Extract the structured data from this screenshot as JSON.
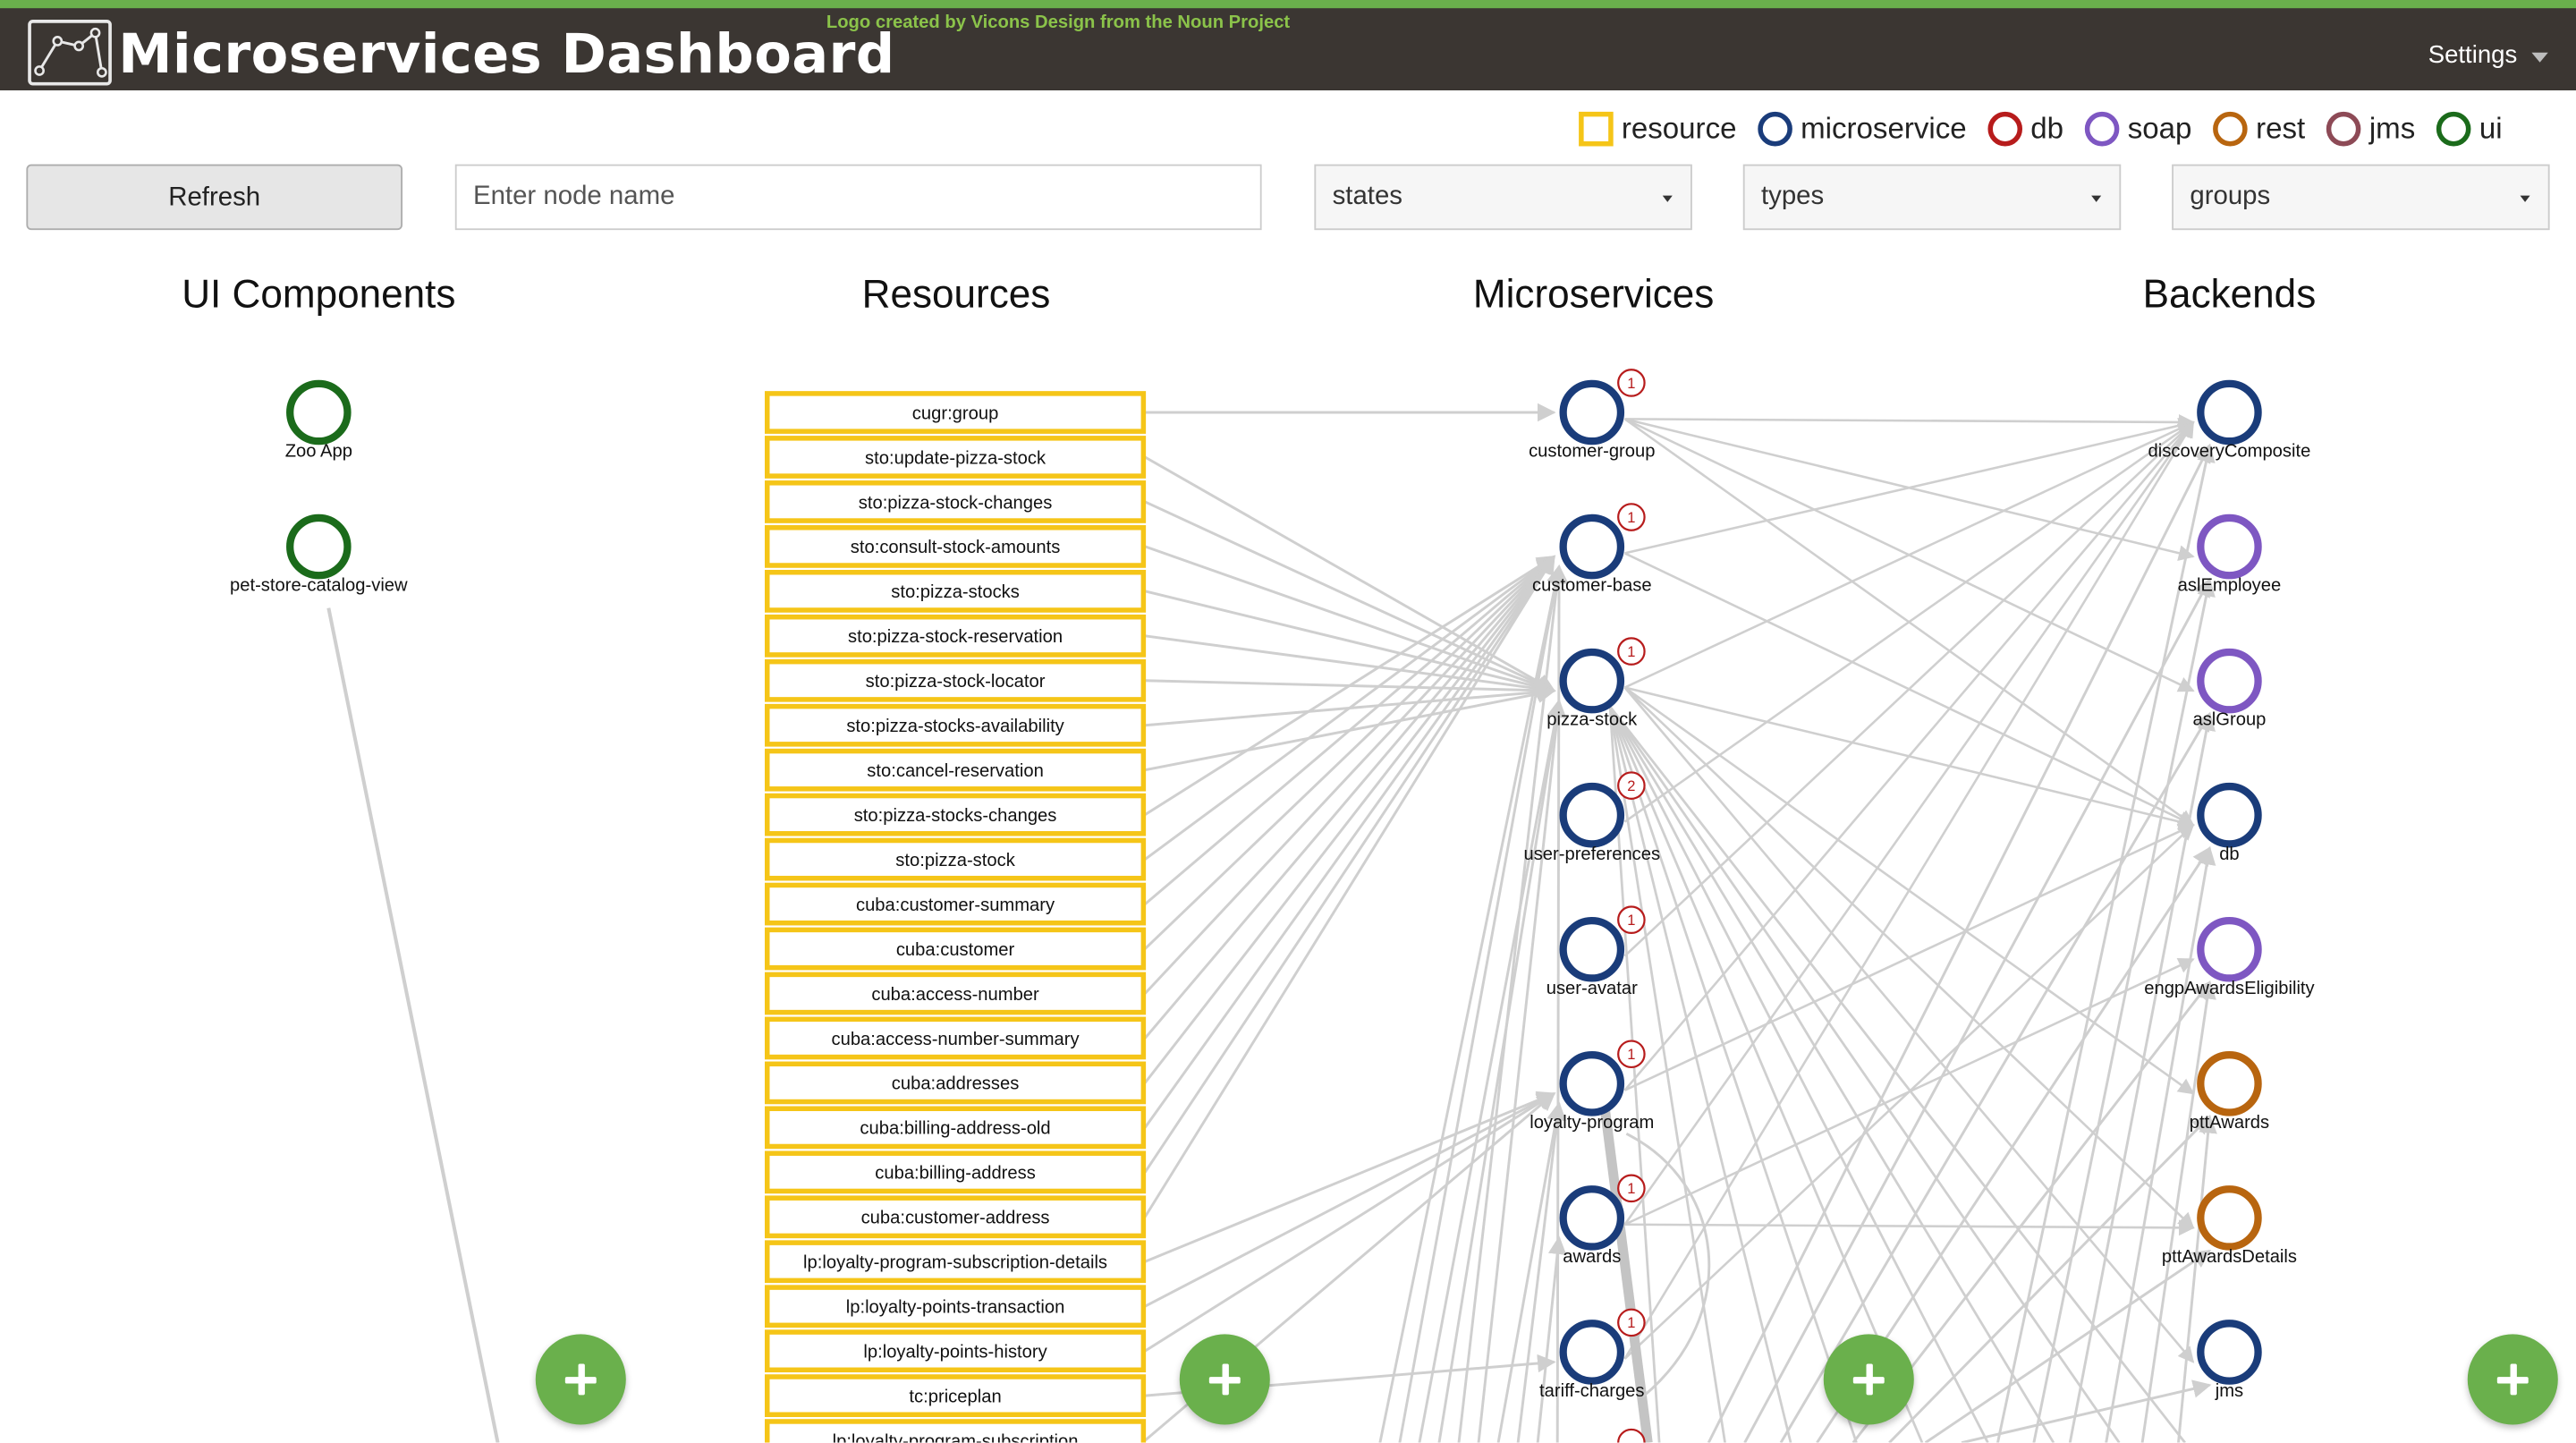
{
  "header": {
    "title": "Microservices Dashboard",
    "credit": "Logo created by Vicons Design from the Noun Project",
    "logo_icon": "graph-line-logo-icon",
    "settings_label": "Settings"
  },
  "legend": [
    {
      "label": "resource",
      "shape": "square",
      "color": "#f5c518"
    },
    {
      "label": "microservice",
      "shape": "circle",
      "color": "#1a3c7a"
    },
    {
      "label": "db",
      "shape": "circle",
      "color": "#b71c1c"
    },
    {
      "label": "soap",
      "shape": "circle",
      "color": "#7e57c2"
    },
    {
      "label": "rest",
      "shape": "circle",
      "color": "#b8650f"
    },
    {
      "label": "jms",
      "shape": "circle",
      "color": "#8d4a56"
    },
    {
      "label": "ui",
      "shape": "circle",
      "color": "#1b6b1b"
    }
  ],
  "controls": {
    "refresh_label": "Refresh",
    "search_placeholder": "Enter node name",
    "states_label": "states",
    "types_label": "types",
    "groups_label": "groups"
  },
  "columns": [
    "UI Components",
    "Resources",
    "Microservices",
    "Backends"
  ],
  "ui_nodes": [
    {
      "label": "Zoo App",
      "type": "ui"
    },
    {
      "label": "pet-store-catalog-view",
      "type": "ui"
    }
  ],
  "resources": [
    "cugr:group",
    "sto:update-pizza-stock",
    "sto:pizza-stock-changes",
    "sto:consult-stock-amounts",
    "sto:pizza-stocks",
    "sto:pizza-stock-reservation",
    "sto:pizza-stock-locator",
    "sto:pizza-stocks-availability",
    "sto:cancel-reservation",
    "sto:pizza-stocks-changes",
    "sto:pizza-stock",
    "cuba:customer-summary",
    "cuba:customer",
    "cuba:access-number",
    "cuba:access-number-summary",
    "cuba:addresses",
    "cuba:billing-address-old",
    "cuba:billing-address",
    "cuba:customer-address",
    "lp:loyalty-program-subscription-details",
    "lp:loyalty-points-transaction",
    "lp:loyalty-points-history",
    "tc:priceplan",
    "lp:loyalty-program-subscription"
  ],
  "microservices": [
    {
      "label": "customer-group",
      "badge": "1"
    },
    {
      "label": "customer-base",
      "badge": "1"
    },
    {
      "label": "pizza-stock",
      "badge": "1"
    },
    {
      "label": "user-preferences",
      "badge": "2"
    },
    {
      "label": "user-avatar",
      "badge": "1"
    },
    {
      "label": "loyalty-program",
      "badge": "1"
    },
    {
      "label": "awards",
      "badge": "1"
    },
    {
      "label": "tariff-charges",
      "badge": "1"
    }
  ],
  "backends": [
    {
      "label": "discoveryComposite",
      "type": "microservice"
    },
    {
      "label": "aslEmployee",
      "type": "soap"
    },
    {
      "label": "aslGroup",
      "type": "soap"
    },
    {
      "label": "db",
      "type": "microservice"
    },
    {
      "label": "engpAwardsEligibility",
      "type": "soap"
    },
    {
      "label": "pttAwards",
      "type": "rest"
    },
    {
      "label": "pttAwardsDetails",
      "type": "rest"
    },
    {
      "label": "jms",
      "type": "microservice"
    }
  ],
  "colors": {
    "ui": "#1b6b1b",
    "microservice": "#1a3c7a",
    "soap": "#7e57c2",
    "rest": "#b8650f",
    "resource": "#f5c518",
    "badge": "#b71c1c",
    "link": "#cfcfcf",
    "fab": "#6ab04c"
  },
  "fab_icon": "plus-icon"
}
